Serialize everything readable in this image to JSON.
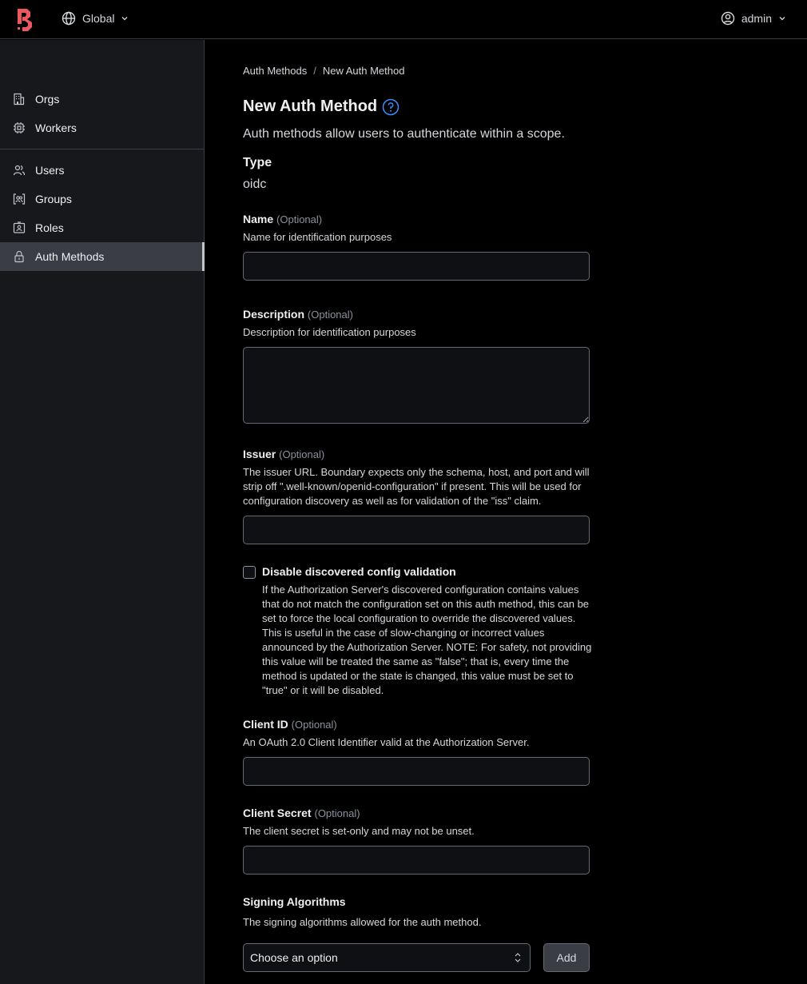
{
  "header": {
    "logo_icon": "boundary-logo-icon",
    "scope": {
      "icon": "globe-icon",
      "label": "Global"
    },
    "user": {
      "icon": "user-circle-icon",
      "label": "admin"
    }
  },
  "sidebar": {
    "groups": [
      [
        {
          "icon": "building-icon",
          "label": "Orgs"
        },
        {
          "icon": "cpu-icon",
          "label": "Workers"
        }
      ],
      [
        {
          "icon": "users-icon",
          "label": "Users"
        },
        {
          "icon": "folder-users-icon",
          "label": "Groups"
        },
        {
          "icon": "id-card-icon",
          "label": "Roles"
        },
        {
          "icon": "lock-icon",
          "label": "Auth Methods",
          "active": true
        }
      ]
    ]
  },
  "breadcrumb": {
    "parent": "Auth Methods",
    "separator": "/",
    "current": "New Auth Method"
  },
  "page": {
    "title": "New Auth Method",
    "subtitle": "Auth methods allow users to authenticate within a scope.",
    "type_label": "Type",
    "type_value": "oidc"
  },
  "form": {
    "optional_tag": "(Optional)",
    "name": {
      "label": "Name",
      "help": "Name for identification purposes",
      "value": ""
    },
    "description": {
      "label": "Description",
      "help": "Description for identification purposes",
      "value": ""
    },
    "issuer": {
      "label": "Issuer",
      "help": "The issuer URL. Boundary expects only the schema, host, and port and will strip off \".well-known/openid-configuration\" if present. This will be used for configuration discovery as well as for validation of the \"iss\" claim.",
      "value": ""
    },
    "disable_validation": {
      "label": "Disable discovered config validation",
      "checked": false,
      "help": "If the Authorization Server's discovered configuration contains values that do not match the configuration set on this auth method, this can be set to force the local configuration to override the discovered values. This is useful in the case of slow-changing or incorrect values announced by the Authorization Server. NOTE: For safety, not providing this value will be treated the same as \"false\"; that is, every time the method is updated or the state is changed, this value must be set to \"true\" or it will be disabled."
    },
    "client_id": {
      "label": "Client ID",
      "help": "An OAuth 2.0 Client Identifier valid at the Authorization Server.",
      "value": ""
    },
    "client_secret": {
      "label": "Client Secret",
      "help": "The client secret is set-only and may not be unset.",
      "value": ""
    },
    "signing_algorithms": {
      "label": "Signing Algorithms",
      "help": "The signing algorithms allowed for the auth method.",
      "select_value": "Choose an option",
      "add_label": "Add"
    }
  }
}
